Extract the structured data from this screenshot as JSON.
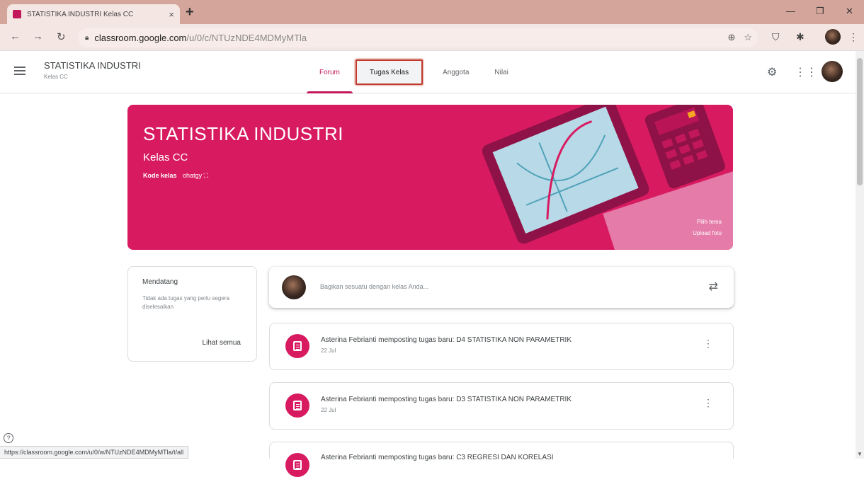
{
  "browser": {
    "tab_title": "STATISTIKA INDUSTRI Kelas CC",
    "url_host": "classroom.google.com",
    "url_path": "/u/0/c/NTUzNDE4MDMyMTla",
    "status_url": "https://classroom.google.com/u/0/w/NTUzNDE4MDMyMTla/t/all"
  },
  "header": {
    "class_name": "STATISTIKA INDUSTRI",
    "class_section": "Kelas CC",
    "tabs": [
      {
        "label": "Forum"
      },
      {
        "label": "Tugas Kelas"
      },
      {
        "label": "Anggota"
      },
      {
        "label": "Nilai"
      }
    ]
  },
  "banner": {
    "title": "STATISTIKA INDUSTRI",
    "subtitle": "Kelas CC",
    "code_label": "Kode kelas",
    "code_value": "ohatgy",
    "theme_link": "Pilih tema",
    "upload_link": "Upload foto"
  },
  "upcoming": {
    "heading": "Mendatang",
    "text": "Tidak ada tugas yang perlu segera diselesaikan",
    "view_all": "Lihat semua"
  },
  "share": {
    "placeholder": "Bagikan sesuatu dengan kelas Anda..."
  },
  "stream": [
    {
      "text": "Asterina Febrianti memposting tugas baru: D4 STATISTIKA NON PARAMETRIK",
      "date": "22 Jul"
    },
    {
      "text": "Asterina Febrianti memposting tugas baru: D3 STATISTIKA NON PARAMETRIK",
      "date": "22 Jul"
    },
    {
      "text": "Asterina Febrianti memposting tugas baru: C3 REGRESI DAN KORELASI",
      "date": ""
    }
  ],
  "colors": {
    "accent": "#d81b60",
    "tab_bar": "#d4a59a"
  }
}
